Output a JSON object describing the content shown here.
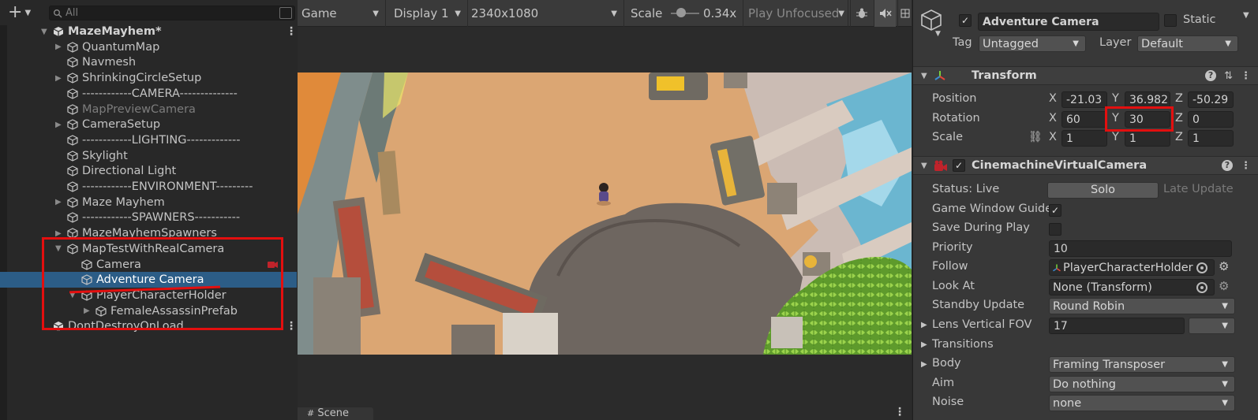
{
  "hierarchy": {
    "search_placeholder": "All",
    "rows": [
      {
        "label": "MazeMayhem*",
        "depth": 0,
        "fold": "down",
        "icon": "unity-scene-icon",
        "type": "scene",
        "kebab": true
      },
      {
        "label": "QuantumMap",
        "depth": 1,
        "fold": "right",
        "icon": "gameobject-cube-icon"
      },
      {
        "label": "Navmesh",
        "depth": 1,
        "fold": "",
        "icon": "gameobject-cube-icon"
      },
      {
        "label": "ShrinkingCircleSetup",
        "depth": 1,
        "fold": "right",
        "icon": "gameobject-cube-icon"
      },
      {
        "label": "------------CAMERA--------------",
        "depth": 1,
        "fold": "",
        "icon": "gameobject-cube-icon"
      },
      {
        "label": "MapPreviewCamera",
        "depth": 1,
        "fold": "",
        "icon": "gameobject-cube-icon",
        "type": "dim"
      },
      {
        "label": "CameraSetup",
        "depth": 1,
        "fold": "right",
        "icon": "gameobject-cube-icon"
      },
      {
        "label": "------------LIGHTING-------------",
        "depth": 1,
        "fold": "",
        "icon": "gameobject-cube-icon"
      },
      {
        "label": "Skylight",
        "depth": 1,
        "fold": "",
        "icon": "gameobject-cube-icon"
      },
      {
        "label": "Directional Light",
        "depth": 1,
        "fold": "",
        "icon": "gameobject-cube-icon"
      },
      {
        "label": "------------ENVIRONMENT---------",
        "depth": 1,
        "fold": "",
        "icon": "gameobject-cube-icon"
      },
      {
        "label": "Maze Mayhem",
        "depth": 1,
        "fold": "right",
        "icon": "gameobject-cube-icon"
      },
      {
        "label": "------------SPAWNERS-----------",
        "depth": 1,
        "fold": "",
        "icon": "gameobject-cube-icon"
      },
      {
        "label": "MazeMayhemSpawners",
        "depth": 1,
        "fold": "right",
        "icon": "gameobject-cube-icon"
      },
      {
        "label": "MapTestWithRealCamera",
        "depth": 1,
        "fold": "down",
        "icon": "gameobject-cube-icon"
      },
      {
        "label": "Camera",
        "depth": 2,
        "fold": "",
        "icon": "gameobject-cube-icon",
        "badge": "camera-gizmo-icon"
      },
      {
        "label": "Adventure Camera",
        "depth": 2,
        "fold": "",
        "icon": "gameobject-cube-icon",
        "type": "sel"
      },
      {
        "label": "PlayerCharacterHolder",
        "depth": 2,
        "fold": "down",
        "icon": "gameobject-cube-icon"
      },
      {
        "label": "FemaleAssassinPrefab",
        "depth": 3,
        "fold": "right",
        "icon": "gameobject-cube-icon"
      },
      {
        "label": "DontDestroyOnLoad",
        "depth": 0,
        "fold": "",
        "icon": "unity-scene-icon",
        "type": "scene-plain",
        "kebab": true
      }
    ]
  },
  "game": {
    "tab": "Game",
    "display": "Display 1",
    "resolution": "2340x1080",
    "scale_label": "Scale",
    "scale_value": "0.34x",
    "play_mode": "Play Unfocused",
    "scene_tab": "Scene",
    "scale_fraction": 0.34,
    "icons": [
      "bug-icon",
      "mute-audio-icon",
      "stats-icon"
    ]
  },
  "inspector": {
    "object_name": "Adventure Camera",
    "static_label": "Static",
    "tag_label": "Tag",
    "tag_value": "Untagged",
    "layer_label": "Layer",
    "layer_value": "Default",
    "transform": {
      "title": "Transform",
      "position_label": "Position",
      "rotation_label": "Rotation",
      "scale_label": "Scale",
      "axes": [
        "X",
        "Y",
        "Z"
      ],
      "position": [
        "-21.03",
        "36.982",
        "-50.29"
      ],
      "rotation": [
        "60",
        "30",
        "0"
      ],
      "scale": [
        "1",
        "1",
        "1"
      ]
    },
    "vcam": {
      "title": "CinemachineVirtualCamera",
      "status_label": "Status: Live",
      "solo_button": "Solo",
      "late_update": "Late Update",
      "game_window_guides_label": "Game Window Guide",
      "game_window_guides": true,
      "save_during_play_label": "Save During Play",
      "save_during_play": false,
      "priority_label": "Priority",
      "priority_value": "10",
      "follow_label": "Follow",
      "follow_value": "PlayerCharacterHolder",
      "lookat_label": "Look At",
      "lookat_value": "None (Transform)",
      "standby_label": "Standby Update",
      "standby_value": "Round Robin",
      "lens_label": "Lens Vertical FOV",
      "lens_value": "17",
      "transitions_label": "Transitions",
      "body_label": "Body",
      "body_value": "Framing Transposer",
      "aim_label": "Aim",
      "aim_value": "Do nothing",
      "noise_label": "Noise",
      "noise_value": "none"
    }
  },
  "colors": {
    "selection": "#2c5d87",
    "annotation_red": "#e30f0f",
    "sand": "#dca872"
  }
}
